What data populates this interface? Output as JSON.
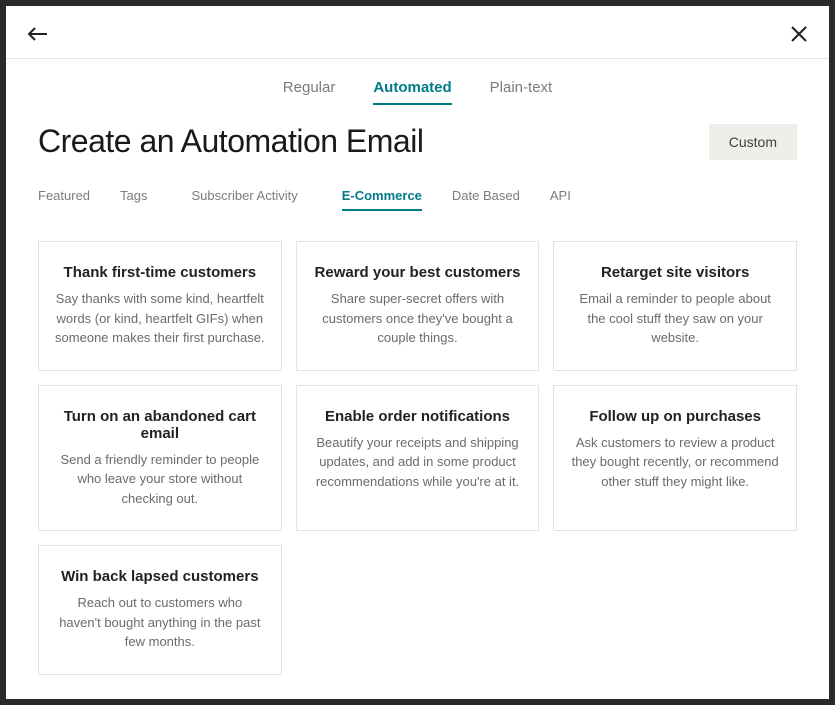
{
  "topTabs": {
    "regular": "Regular",
    "automated": "Automated",
    "plainText": "Plain-text"
  },
  "title": "Create an Automation Email",
  "customButton": "Custom",
  "subTabs": {
    "featured": "Featured",
    "tags": "Tags",
    "subscriberActivity": "Subscriber Activity",
    "ecommerce": "E-Commerce",
    "dateBased": "Date Based",
    "api": "API"
  },
  "cards": {
    "c0": {
      "title": "Thank first-time customers",
      "desc": "Say thanks with some kind, heartfelt words (or kind, heartfelt GIFs) when someone makes their first purchase."
    },
    "c1": {
      "title": "Reward your best customers",
      "desc": "Share super-secret offers with customers once they've bought a couple things."
    },
    "c2": {
      "title": "Retarget site visitors",
      "desc": "Email a reminder to people about the cool stuff they saw on your website."
    },
    "c3": {
      "title": "Turn on an abandoned cart email",
      "desc": "Send a friendly reminder to people who leave your store without checking out."
    },
    "c4": {
      "title": "Enable order notifications",
      "desc": "Beautify your receipts and shipping updates, and add in some product recommendations while you're at it."
    },
    "c5": {
      "title": "Follow up on purchases",
      "desc": "Ask customers to review a product they bought recently, or recommend other stuff they might like."
    },
    "c6": {
      "title": "Win back lapsed customers",
      "desc": "Reach out to customers who haven't bought anything in the past few months."
    }
  }
}
